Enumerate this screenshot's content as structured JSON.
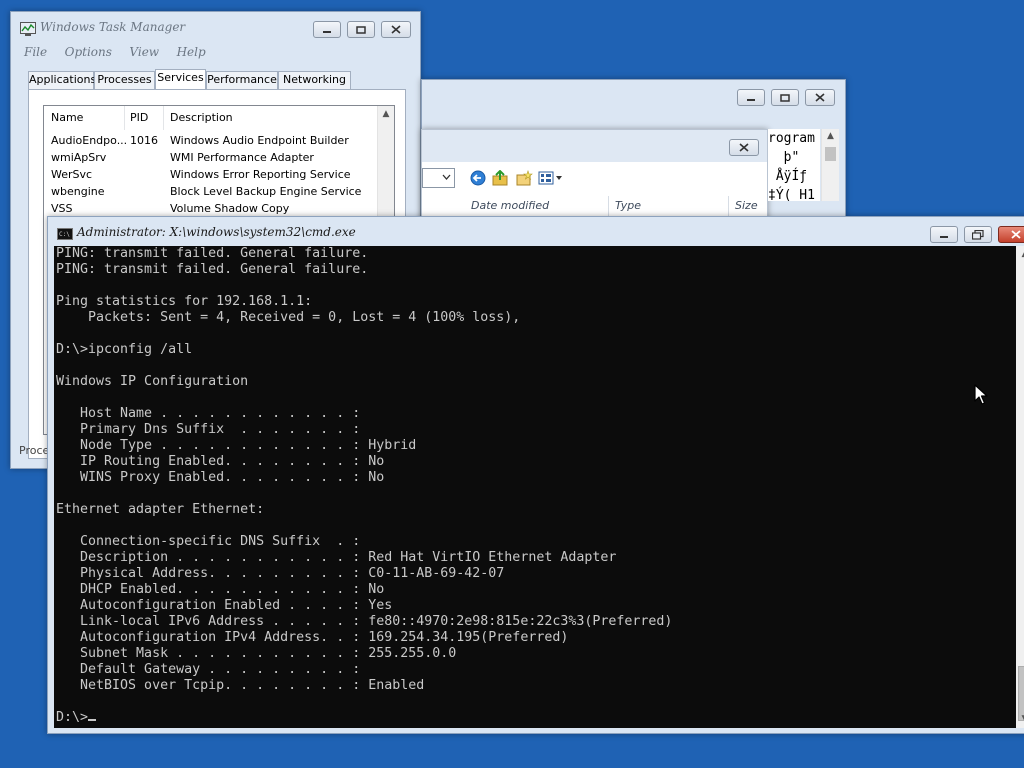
{
  "taskmgr": {
    "title": "Windows Task Manager",
    "menu": [
      "File",
      "Options",
      "View",
      "Help"
    ],
    "tabs": [
      "Applications",
      "Processes",
      "Services",
      "Performance",
      "Networking"
    ],
    "active_tab": "Services",
    "columns": [
      "Name",
      "PID",
      "Description"
    ],
    "rows": [
      {
        "name": "AudioEndpo...",
        "pid": "1016",
        "desc": "Windows Audio Endpoint Builder"
      },
      {
        "name": "wmiApSrv",
        "pid": "",
        "desc": "WMI Performance Adapter"
      },
      {
        "name": "WerSvc",
        "pid": "",
        "desc": "Windows Error Reporting Service"
      },
      {
        "name": "wbengine",
        "pid": "",
        "desc": "Block Level Backup Engine Service"
      },
      {
        "name": "VSS",
        "pid": "",
        "desc": "Volume Shadow Copy"
      }
    ],
    "status_text": "Proce"
  },
  "explorer": {
    "columns": [
      "Date modified",
      "Type",
      "Size"
    ],
    "garbled_text": "rogram\n  þ\"\n ÅÿÍƒ\n‡Ý( H1"
  },
  "cmd": {
    "title": "Administrator: X:\\windows\\system32\\cmd.exe",
    "lines": [
      "PING: transmit failed. General failure.",
      "PING: transmit failed. General failure.",
      "",
      "Ping statistics for 192.168.1.1:",
      "    Packets: Sent = 4, Received = 0, Lost = 4 (100% loss),",
      "",
      "D:\\>ipconfig /all",
      "",
      "Windows IP Configuration",
      "",
      "   Host Name . . . . . . . . . . . . :",
      "   Primary Dns Suffix  . . . . . . . :",
      "   Node Type . . . . . . . . . . . . : Hybrid",
      "   IP Routing Enabled. . . . . . . . : No",
      "   WINS Proxy Enabled. . . . . . . . : No",
      "",
      "Ethernet adapter Ethernet:",
      "",
      "   Connection-specific DNS Suffix  . :",
      "   Description . . . . . . . . . . . : Red Hat VirtIO Ethernet Adapter",
      "   Physical Address. . . . . . . . . : C0-11-AB-69-42-07",
      "   DHCP Enabled. . . . . . . . . . . : No",
      "   Autoconfiguration Enabled . . . . : Yes",
      "   Link-local IPv6 Address . . . . . : fe80::4970:2e98:815e:22c3%3(Preferred)",
      "   Autoconfiguration IPv4 Address. . : 169.254.34.195(Preferred)",
      "   Subnet Mask . . . . . . . . . . . : 255.255.0.0",
      "   Default Gateway . . . . . . . . . :",
      "   NetBIOS over Tcpip. . . . . . . . : Enabled",
      "",
      "D:\\>"
    ]
  },
  "colors": {
    "desktop": "#1f62b4",
    "console_bg": "#0c0c0c",
    "console_fg": "#c9c9c9",
    "window_frame": "#dbe6f3"
  }
}
